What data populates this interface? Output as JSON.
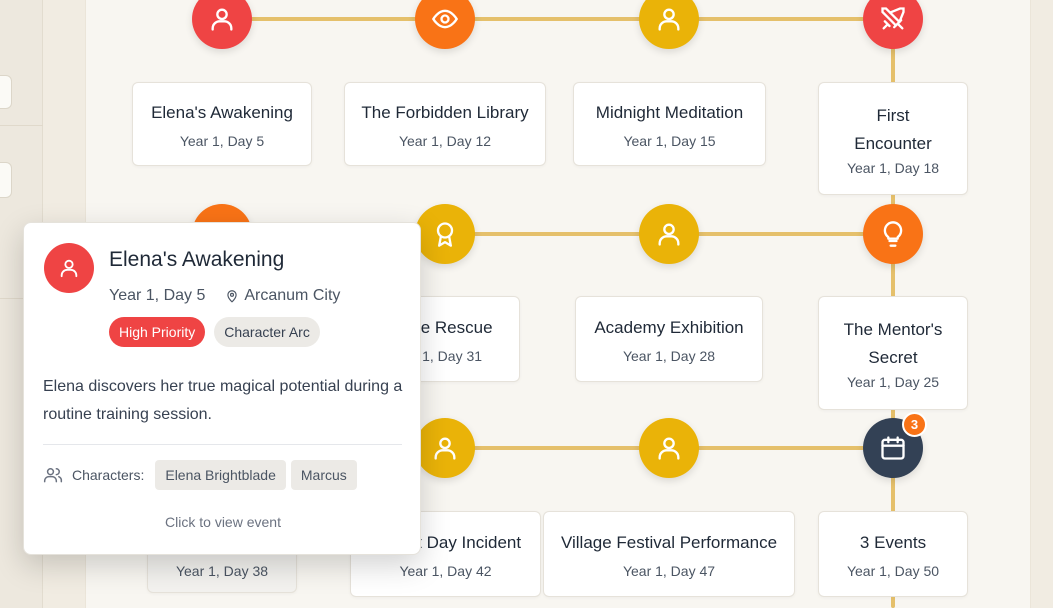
{
  "timeline": {
    "row1": [
      {
        "title": "Elena's Awakening",
        "date": "Year 1, Day 5",
        "icon": "user-icon",
        "color": "#ef4444"
      },
      {
        "title": "The Forbidden Library",
        "date": "Year 1, Day 12",
        "icon": "eye-icon",
        "color": "#f97316"
      },
      {
        "title": "Midnight Meditation",
        "date": "Year 1, Day 15",
        "icon": "user-icon",
        "color": "#eab308"
      },
      {
        "title": "First Encounter",
        "date": "Year 1, Day 18",
        "icon": "crossed-swords-icon",
        "color": "#ef4444"
      }
    ],
    "row2": [
      {
        "title": "Village Rescue",
        "date": "Year 1, Day 31",
        "icon": "award-icon",
        "color": "#eab308"
      },
      {
        "title": "Academy Exhibition",
        "date": "Year 1, Day 28",
        "icon": "user-icon",
        "color": "#eab308"
      },
      {
        "title": "The Mentor's Secret",
        "date": "Year 1, Day 25",
        "icon": "lightbulb-icon",
        "color": "#f97316"
      }
    ],
    "row3": [
      {
        "title": "",
        "date": "Year 1, Day 38"
      },
      {
        "title": "Market Day Incident",
        "date": "Year 1, Day 42",
        "icon": "user-icon",
        "color": "#eab308"
      },
      {
        "title": "Village Festival Performance",
        "date": "Year 1, Day 47",
        "icon": "user-icon",
        "color": "#eab308"
      },
      {
        "title": "3 Events",
        "date": "Year 1, Day 50",
        "icon": "calendar-icon",
        "color": "#334155",
        "badge": "3"
      }
    ]
  },
  "popup": {
    "title": "Elena's Awakening",
    "date": "Year 1, Day 5",
    "location": "Arcanum City",
    "tags": [
      "High Priority",
      "Character Arc"
    ],
    "description": "Elena discovers her true magical potential during a routine training session.",
    "characters_label": "Characters:",
    "characters": [
      "Elena Brightblade",
      "Marcus"
    ],
    "footer": "Click to view event"
  },
  "colors": {
    "accent_line": "#e5c06b",
    "red": "#ef4444",
    "orange": "#f97316",
    "yellow": "#eab308",
    "dark": "#334155"
  }
}
